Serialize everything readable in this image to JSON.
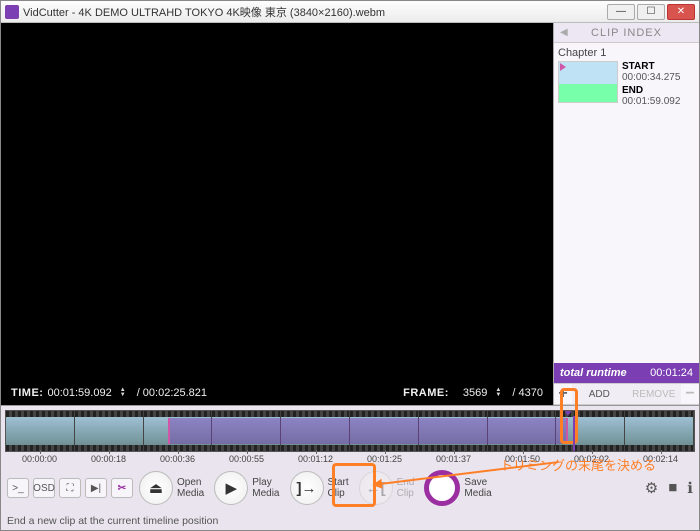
{
  "window": {
    "title": "VidCutter - 4K DEMO ULTRAHD TOKYO 4K映像 東京 (3840×2160).webm"
  },
  "player": {
    "time_label": "TIME:",
    "time_value": "00:01:59.092",
    "time_total": "/ 00:02:25.821",
    "frame_label": "FRAME:",
    "frame_value": "3569",
    "frame_total": "/ 4370"
  },
  "clip_index": {
    "header": "CLIP INDEX",
    "chapter": "Chapter 1",
    "start_label": "START",
    "start_value": "00:00:34.275",
    "end_label": "END",
    "end_value": "00:01:59.092",
    "runtime_label": "total runtime",
    "runtime_value": "00:01:24",
    "add_label": "ADD",
    "remove_label": "REMOVE"
  },
  "timeline": {
    "ticks": [
      "00:00:00",
      "00:00:18",
      "00:00:36",
      "00:00:55",
      "00:01:12",
      "00:01:25",
      "00:01:37",
      "00:01:50",
      "00:02:02",
      "00:02:14"
    ]
  },
  "toolbar": {
    "open_media": "Open\nMedia",
    "play_media": "Play\nMedia",
    "start_clip": "Start\nClip",
    "end_clip": "End\nClip",
    "save_media": "Save\nMedia",
    "osd": "OSD"
  },
  "statusbar": {
    "text": "End a new clip at the current timeline position"
  },
  "annotation": {
    "text": "トリミングの末尾を決める"
  }
}
